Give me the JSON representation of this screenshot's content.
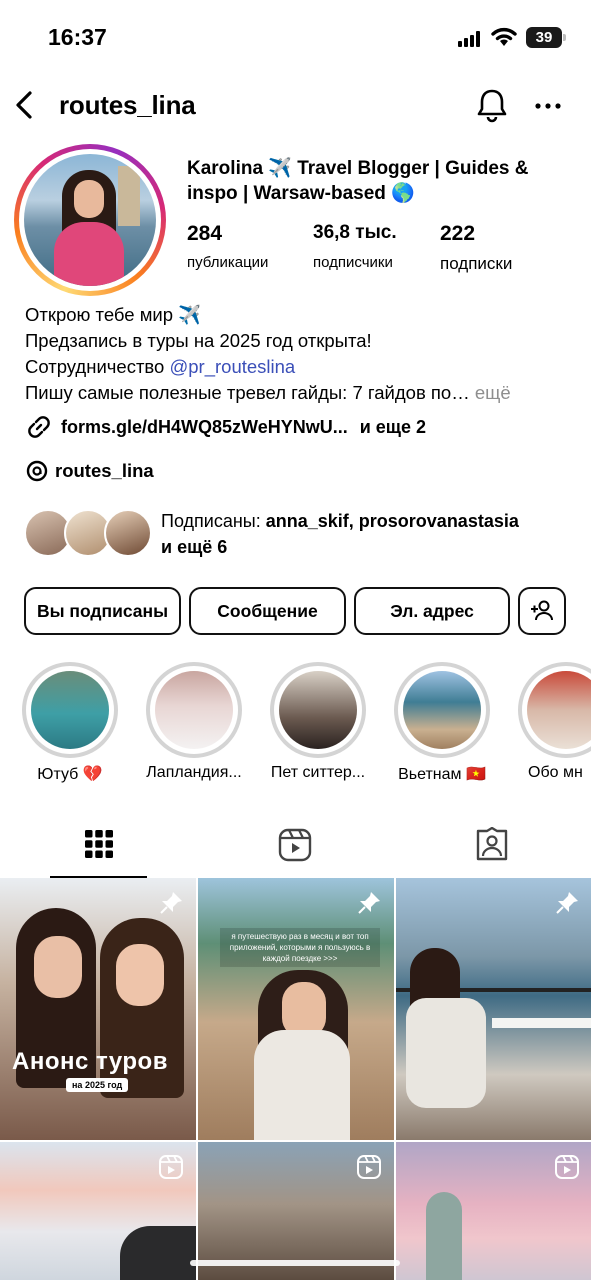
{
  "status_bar": {
    "time": "16:37",
    "battery": "39"
  },
  "header": {
    "username": "routes_lina",
    "icons": [
      "back-arrow-icon",
      "bell-icon",
      "more-icon"
    ]
  },
  "profile": {
    "display_name": "Karolina ✈️ Travel Blogger | Guides & inspo | Warsaw-based 🌎",
    "stats": [
      {
        "value": "284",
        "label": "публикации"
      },
      {
        "value": "36,8 тыс.",
        "label": "подписчики"
      },
      {
        "value": "222",
        "label": "подписки"
      }
    ],
    "bio_lines": {
      "l1": "Открою тебе мир ✈️",
      "l2": "Предзапись в туры на 2025 год открыта!",
      "l3_prefix": "Сотрудничество ",
      "l3_mention": "@pr_routeslina",
      "l4": "Пишу самые полезные тревел гайды: 7 гайдов по…",
      "l4_more": "ещё"
    },
    "link": {
      "text": "forms.gle/dH4WQ85zWeHYNwU...",
      "more": "и еще 2"
    },
    "threads": "routes_lina",
    "followed_by": {
      "prefix": "Подписаны: ",
      "names": "anna_skif, prosorovanastasia",
      "suffix": "и ещё 6"
    }
  },
  "actions": {
    "following": "Вы подписаны",
    "message": "Сообщение",
    "email": "Эл. адрес"
  },
  "highlights": [
    {
      "label": "Ютуб 💔"
    },
    {
      "label": "Лапландия..."
    },
    {
      "label": "Пет ситтер..."
    },
    {
      "label": "Вьетнам 🇻🇳"
    },
    {
      "label": "Обо мн"
    }
  ],
  "tabs": [
    "grid-icon",
    "reels-icon",
    "tagged-icon"
  ],
  "posts": [
    {
      "type": "pinned",
      "overlay": "Анонс туров",
      "sub": "на 2025 год"
    },
    {
      "type": "pinned",
      "overlay": "я путешествую раз в месяц и вот топ приложений, которыми я пользуюсь в каждой поездке >>>"
    },
    {
      "type": "pinned"
    },
    {
      "type": "reel"
    },
    {
      "type": "reel"
    },
    {
      "type": "reel"
    }
  ],
  "colors": {
    "mention": "#3b4fb8",
    "muted": "#8e8e8e",
    "highlight_ring": "#d4d4d4"
  }
}
